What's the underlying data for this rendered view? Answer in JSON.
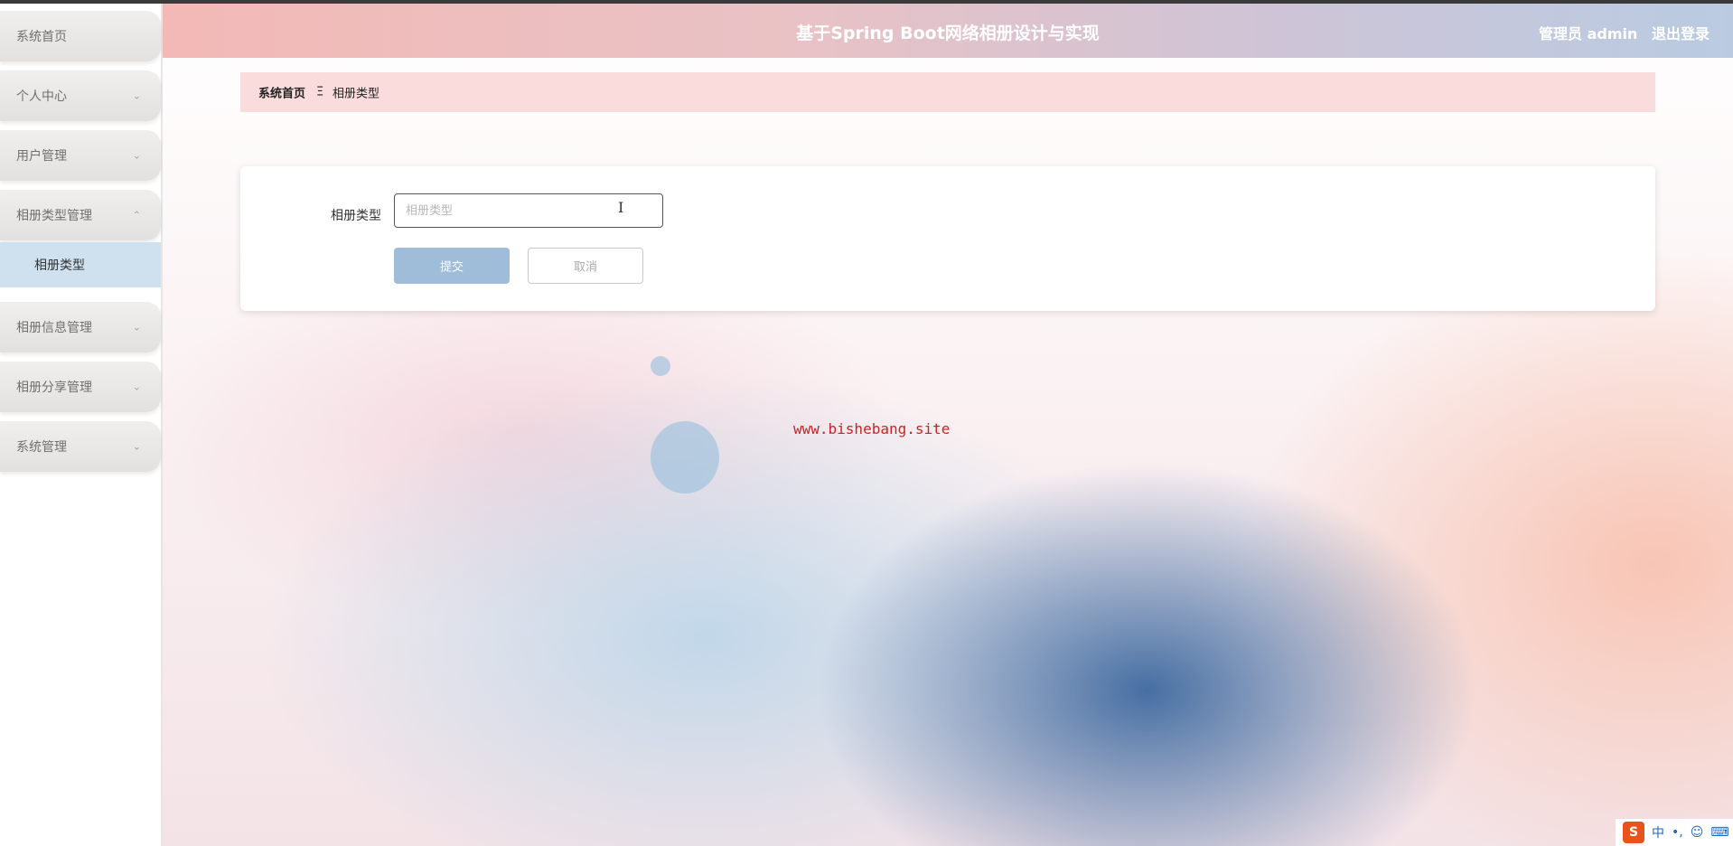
{
  "app": {
    "title": "基于Spring Boot网络相册设计与实现",
    "user_label": "管理员 admin",
    "logout_label": "退出登录"
  },
  "sidebar": {
    "items": [
      {
        "label": "系统首页",
        "has_chevron": false
      },
      {
        "label": "个人中心",
        "has_chevron": true
      },
      {
        "label": "用户管理",
        "has_chevron": true
      },
      {
        "label": "相册类型管理",
        "has_chevron": true,
        "expanded": true
      },
      {
        "label": "相册信息管理",
        "has_chevron": true
      },
      {
        "label": "相册分享管理",
        "has_chevron": true
      },
      {
        "label": "系统管理",
        "has_chevron": true
      }
    ],
    "submenu": {
      "label": "相册类型",
      "active": true
    },
    "chevron_down": "⌄",
    "chevron_up": "⌃"
  },
  "breadcrumb": {
    "home": "系统首页",
    "separator": "Ξ",
    "current": "相册类型"
  },
  "form": {
    "field_label": "相册类型",
    "field_value": "",
    "field_placeholder": "相册类型",
    "submit_label": "提交",
    "cancel_label": "取消"
  },
  "watermark": "www.bishebang.site",
  "ime": {
    "logo": "S",
    "mode": "中",
    "punct": "•,",
    "emoji_icon": "☺",
    "keyboard_icon": "⌨"
  },
  "colors": {
    "header_start": "#f3b9b6",
    "header_end": "#b9cbe2",
    "breadcrumb_bg": "#fadcdc",
    "submit_bg": "#9fbcd8",
    "active_submenu_bg": "#cfe0ee",
    "watermark": "#cc2222"
  }
}
